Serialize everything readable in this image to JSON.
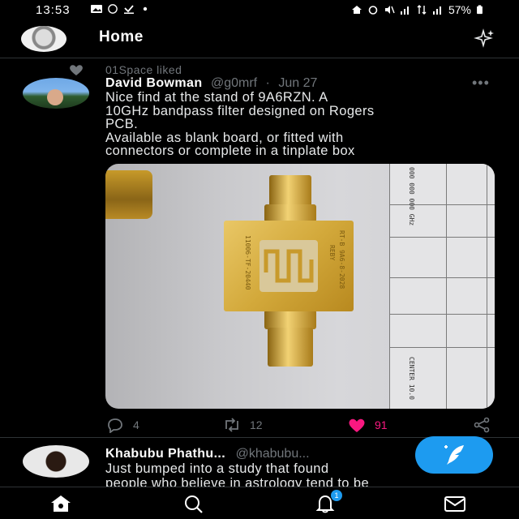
{
  "status_bar": {
    "time": "13:53",
    "battery": "57%"
  },
  "header": {
    "title": "Home"
  },
  "tweets": [
    {
      "social_context": "01Space liked",
      "name": "David Bowman",
      "handle": "@g0mrf",
      "separator": "·",
      "date": "Jun 27",
      "text_lines": [
        "Nice find at the stand of 9A6RZN.  A",
        "10GHz bandpass filter designed on Rogers",
        "PCB.",
        "Available as blank board, or fitted with",
        "connectors or complete in a tinplate box"
      ],
      "replies": "4",
      "retweets": "12",
      "likes": "91",
      "photo_labels": {
        "pcb_left": "11006-TF-20440",
        "pcb_right": "RT-B 9A6-8-2028",
        "pcb_right2": "REBY",
        "paper_top": "000  000  000  GHz",
        "paper_bottom": "CENTER  10.0"
      }
    },
    {
      "name": "Khabubu Phathu...",
      "handle": "@khabubu...",
      "text_lines": [
        "Just bumped into a study that found",
        "people who believe in astrology tend to be"
      ]
    }
  ],
  "bottom_nav": {
    "notifications_badge": "1"
  },
  "colors": {
    "accent": "#1d9bf0",
    "like": "#f91880",
    "muted": "#71767b",
    "background": "#000000"
  }
}
